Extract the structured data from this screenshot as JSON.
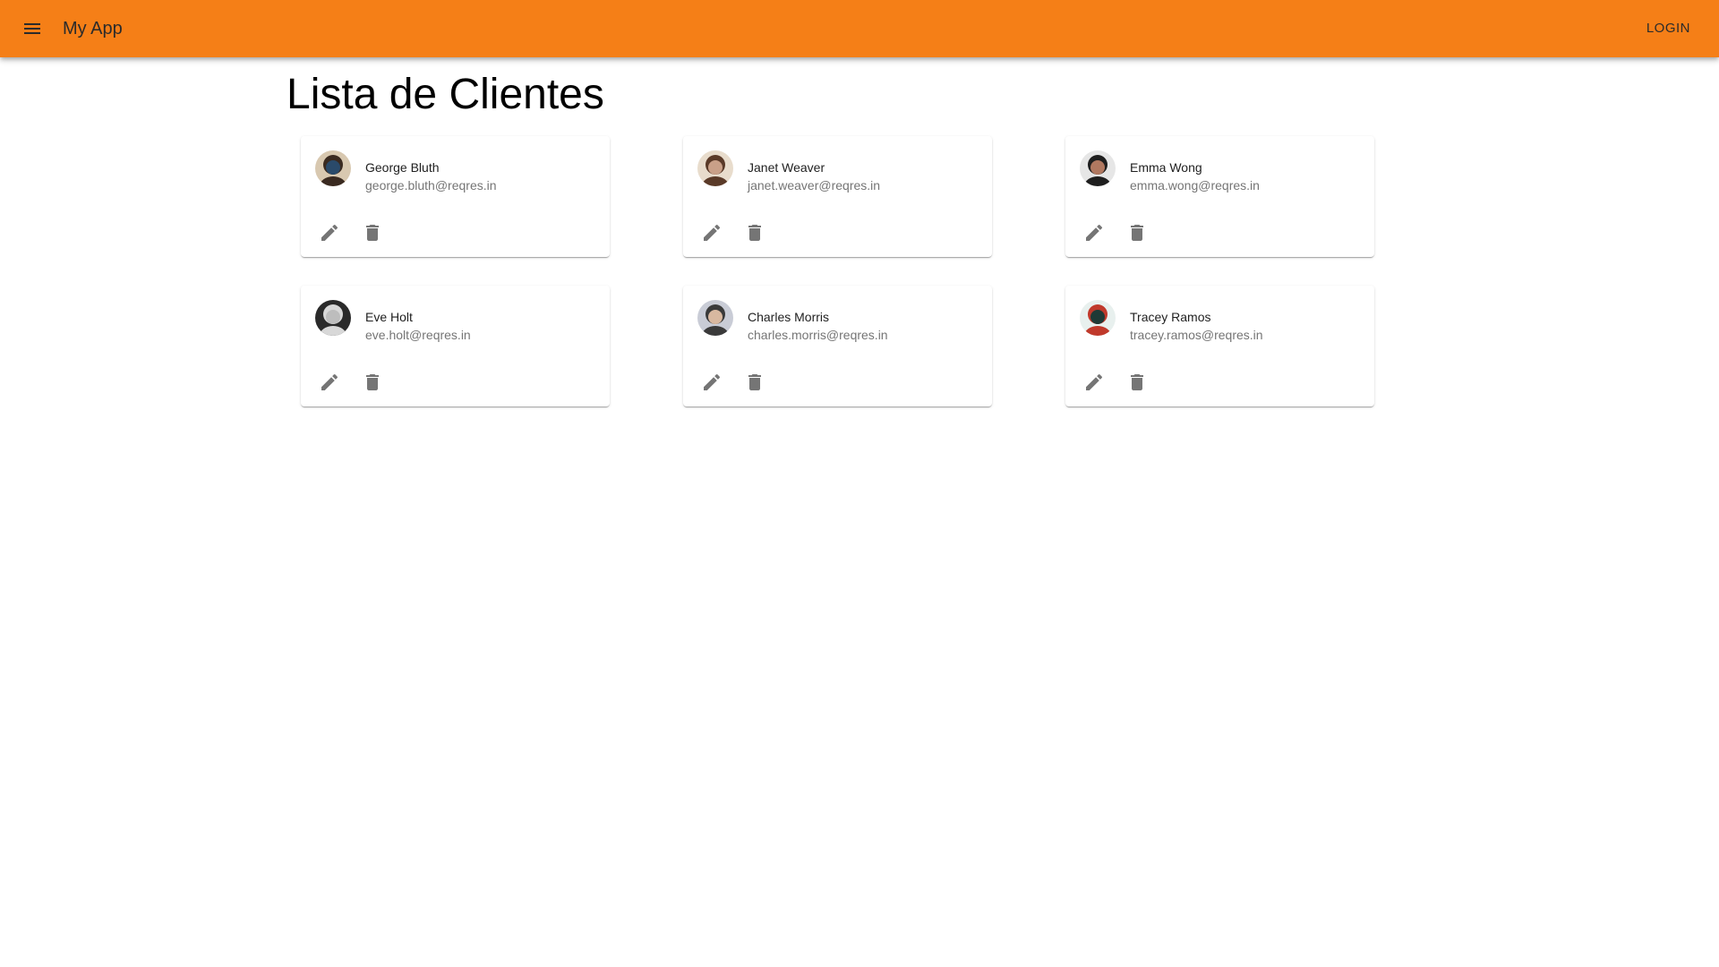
{
  "appbar": {
    "title": "My App",
    "login_label": "LOGIN",
    "color": "#f57f17"
  },
  "page": {
    "title": "Lista de Clientes"
  },
  "clients": [
    {
      "name": "George Bluth",
      "email": "george.bluth@reqres.in",
      "avatar_palette": [
        "#d8c8b0",
        "#3a2a20",
        "#2a4a6a"
      ]
    },
    {
      "name": "Janet Weaver",
      "email": "janet.weaver@reqres.in",
      "avatar_palette": [
        "#e8dccc",
        "#5a3a28",
        "#c9a088"
      ]
    },
    {
      "name": "Emma Wong",
      "email": "emma.wong@reqres.in",
      "avatar_palette": [
        "#e6e6e6",
        "#1e1e1e",
        "#b07860"
      ]
    },
    {
      "name": "Eve Holt",
      "email": "eve.holt@reqres.in",
      "avatar_palette": [
        "#2a2a2a",
        "#d8d8d8",
        "#bdbdbd"
      ]
    },
    {
      "name": "Charles Morris",
      "email": "charles.morris@reqres.in",
      "avatar_palette": [
        "#c9ccd6",
        "#3a3a3a",
        "#d8b8a0"
      ]
    },
    {
      "name": "Tracey Ramos",
      "email": "tracey.ramos@reqres.in",
      "avatar_palette": [
        "#e8f0ee",
        "#c0392b",
        "#1f3a36"
      ]
    }
  ],
  "icons": {
    "menu": "menu-icon",
    "edit": "pencil-icon",
    "delete": "trash-icon"
  }
}
